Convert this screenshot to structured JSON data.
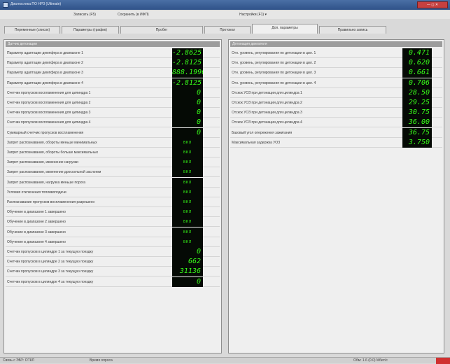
{
  "window": {
    "title": "Диагностика ПО НРЗ (Ultimate)",
    "controls": "— ◻ ✕"
  },
  "menu": [
    "Записать (F5)",
    "Сохранить (в ИФП)",
    "Настройки (F1) ▾"
  ],
  "tabs": [
    {
      "label": "Переменные (список)",
      "active": false
    },
    {
      "label": "Параметры (график)",
      "active": false
    },
    {
      "label": "Пробег",
      "active": false
    },
    {
      "label": "Протокол",
      "active": false
    },
    {
      "label": "Доп. параметры",
      "active": true
    },
    {
      "label": "Правильно запись",
      "active": false
    }
  ],
  "left_panel": {
    "header": "Датчик детонации",
    "rows": [
      {
        "label": "Параметр адаптации демпфера в диапазоне 1",
        "value": "-2.8625"
      },
      {
        "label": "Параметр адаптации демпфера в диапазоне 2",
        "value": "-2.8125"
      },
      {
        "label": "Параметр адаптации демпфера в диапазоне 3",
        "value": "888.1996"
      },
      {
        "label": "Параметр адаптации демпфера в диапазоне 4",
        "value": "-2.8125"
      },
      {
        "label": "Счетчик пропусков воспламенения для цилиндра 1",
        "value": "0"
      },
      {
        "label": "Счетчик пропусков воспламенения для цилиндра 2",
        "value": "0"
      },
      {
        "label": "Счетчик пропусков воспламенения для цилиндра 3",
        "value": "0"
      },
      {
        "label": "Счетчик пропусков воспламенения для цилиндра 4",
        "value": "0"
      },
      {
        "label": "Суммарный счетчик пропусков воспламенения",
        "value": "0"
      },
      {
        "label": "Запрет распознавания, обороты меньше минимальных",
        "value": "ВКЛ",
        "small": true
      },
      {
        "label": "Запрет распознавания, обороты больше максимальных",
        "value": "ВКЛ",
        "small": true
      },
      {
        "label": "Запрет распознавания, изменение нагрузки",
        "value": "ВКЛ",
        "small": true
      },
      {
        "label": "Запрет распознавания, изменение дроссельной заслонки",
        "value": "ВКЛ",
        "small": true
      },
      {
        "label": "Запрет распознавания, нагрузка меньше порога",
        "value": "ВКЛ",
        "small": true
      },
      {
        "label": "Условия отключения топливоподачи",
        "value": "ВКЛ",
        "small": true
      },
      {
        "label": "Распознавание пропусков воспламенения разрешено",
        "value": "ВКЛ",
        "small": true
      },
      {
        "label": "Обучение в диапазоне 1 завершено",
        "value": "ВКЛ",
        "small": true
      },
      {
        "label": "Обучение в диапазоне 2 завершено",
        "value": "ВКЛ",
        "small": true
      },
      {
        "label": "Обучение в диапазоне 3 завершено",
        "value": "ВКЛ",
        "small": true
      },
      {
        "label": "Обучение в диапазоне 4 завершено",
        "value": "ВКЛ",
        "small": true
      },
      {
        "label": "Счетчик пропусков в цилиндре 1 за текущую поездку",
        "value": "0"
      },
      {
        "label": "Счетчик пропусков в цилиндре 2 за текущую поездку",
        "value": "662"
      },
      {
        "label": "Счетчик пропусков в цилиндре 3 за текущую поездку",
        "value": "31136"
      },
      {
        "label": "Счетчик пропусков в цилиндре 4 за текущую поездку",
        "value": "0"
      }
    ]
  },
  "right_panel": {
    "header": "Детонация двигателя",
    "rows": [
      {
        "label": "Отн. уровень, регулирования по детонации в цил. 1",
        "value": "0.471"
      },
      {
        "label": "Отн. уровень, регулирования по детонации в цил. 2",
        "value": "0.620"
      },
      {
        "label": "Отн. уровень, регулирования по детонации в цил. 3",
        "value": "0.661"
      },
      {
        "label": "Отн. уровень, регулирования по детонации в цил. 4",
        "value": "0.706"
      },
      {
        "label": "Отскок УОЗ при детонации для цилиндра 1",
        "value": "28.50"
      },
      {
        "label": "Отскок УОЗ при детонации для цилиндра 2",
        "value": "29.25"
      },
      {
        "label": "Отскок УОЗ при детонации для цилиндра 3",
        "value": "30.75"
      },
      {
        "label": "Отскок УОЗ при детонации для цилиндра 4",
        "value": "36.00"
      },
      {
        "label": "Базовый угол опережения зажигания",
        "value": "36.75"
      },
      {
        "label": "Максимальная задержка УОЗ",
        "value": "3.750"
      }
    ]
  },
  "status": [
    "Связь с ЭБУ: ОТКЛ",
    "Время опроса",
    "Обм: 1.6 (0.0) Мбит/с"
  ]
}
